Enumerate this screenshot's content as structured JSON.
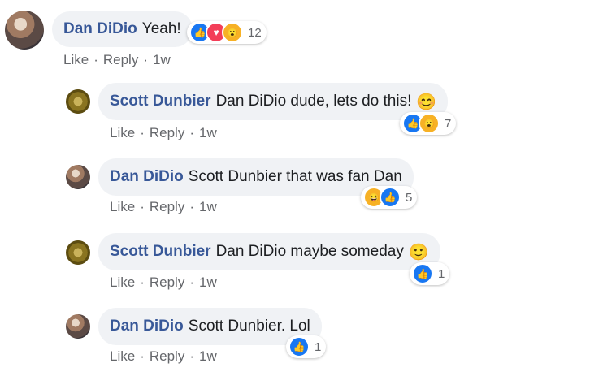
{
  "actions": {
    "like": "Like",
    "reply": "Reply",
    "separator": "·"
  },
  "comments": [
    {
      "author": "Dan DiDio",
      "text": "Yeah!",
      "emoji": "",
      "time": "1w",
      "reaction_count": "12"
    },
    {
      "author": "Scott Dunbier",
      "text": "Dan DiDio dude, lets do this!",
      "emoji": "😊",
      "time": "1w",
      "reaction_count": "7"
    },
    {
      "author": "Dan DiDio",
      "text": "Scott Dunbier that was fan Dan",
      "emoji": "",
      "time": "1w",
      "reaction_count": "5"
    },
    {
      "author": "Scott Dunbier",
      "text": "Dan DiDio maybe someday",
      "emoji": "🙂",
      "time": "1w",
      "reaction_count": "1"
    },
    {
      "author": "Dan DiDio",
      "text": "Scott Dunbier. Lol",
      "emoji": "",
      "time": "1w",
      "reaction_count": "1"
    }
  ],
  "reaction_icons": {
    "like": "like-icon",
    "love": "love-icon",
    "wow": "wow-icon",
    "haha": "haha-icon"
  },
  "colors": {
    "author": "#385898",
    "bubble": "#f0f2f5",
    "like": "#1877f2",
    "love": "#f33e58",
    "wow": "#f7b125"
  }
}
